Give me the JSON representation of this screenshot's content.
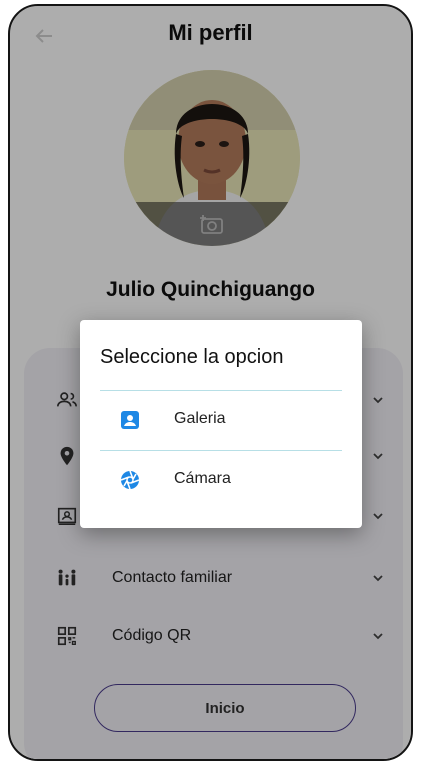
{
  "header": {
    "title": "Mi perfil"
  },
  "profile": {
    "name": "Julio Quinchiguango"
  },
  "menu": {
    "items": [
      {
        "icon": "person-icon",
        "label": ""
      },
      {
        "icon": "location-pin-icon",
        "label": ""
      },
      {
        "icon": "id-card-icon",
        "label": ""
      },
      {
        "icon": "family-icon",
        "label": "Contacto familiar"
      },
      {
        "icon": "qr-code-icon",
        "label": "Código QR"
      }
    ]
  },
  "buttons": {
    "home": "Inicio"
  },
  "dialog": {
    "title": "Seleccione la opcion",
    "options": [
      {
        "icon": "gallery-icon",
        "label": "Galeria",
        "color": "#1e88e5"
      },
      {
        "icon": "camera-aperture-icon",
        "label": "Cámara",
        "color": "#1e88e5"
      }
    ]
  },
  "colors": {
    "accent": "#4a3c8c",
    "divider": "#b7dfe6",
    "card": "#f2f0f7"
  }
}
